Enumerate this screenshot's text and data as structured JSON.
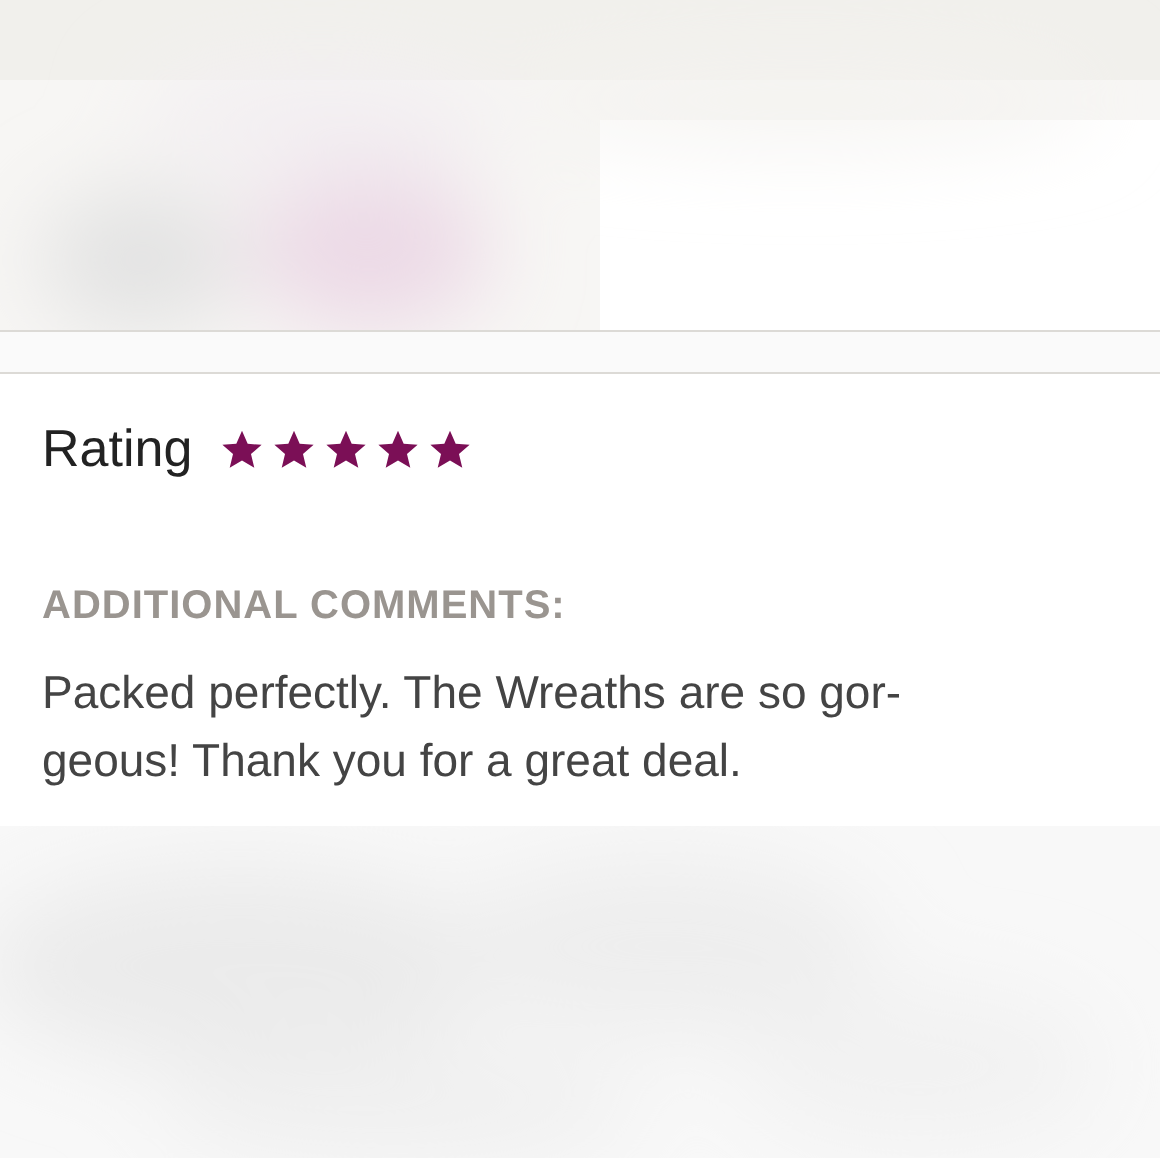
{
  "review": {
    "title": "Rating",
    "stars": 5,
    "comments_label": "ADDITIONAL COMMENTS:",
    "comment": "Packed perfectly. The Wreaths are so gor-geous! Thank you for a great deal."
  }
}
